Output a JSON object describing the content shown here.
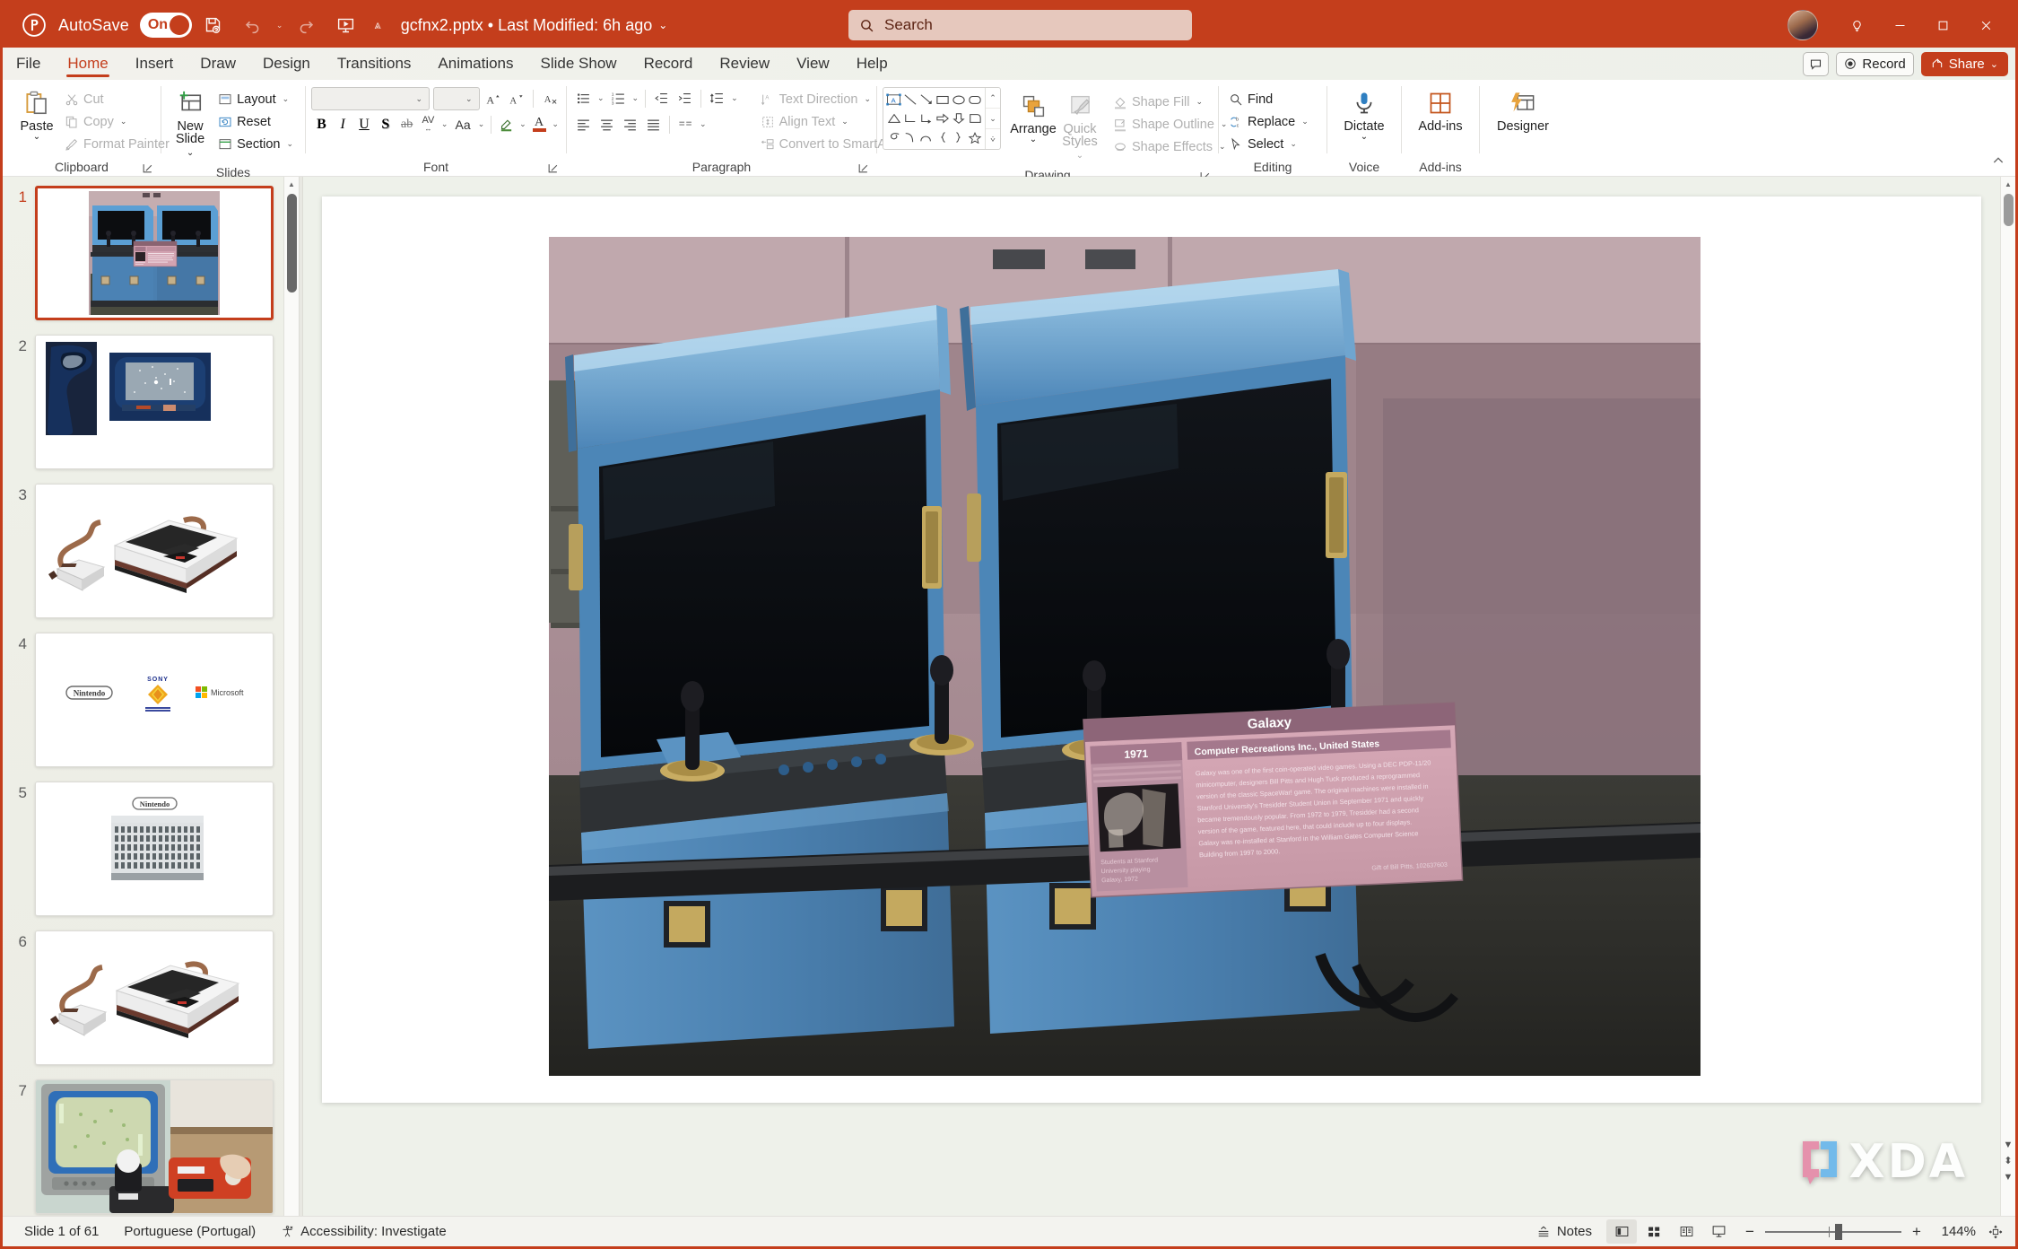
{
  "titlebar": {
    "app_icon": "powerpoint-icon",
    "autosave_label": "AutoSave",
    "autosave_state": "On",
    "filename": "gcfnx2.pptx",
    "modified": "Last Modified: 6h ago",
    "filename_full": "gcfnx2.pptx • Last Modified: 6h ago",
    "quick_access": [
      "save-icon",
      "undo-icon",
      "redo-icon",
      "start-presentation-icon",
      "customize-quick-access-icon"
    ],
    "window_controls": [
      "minimize",
      "maximize",
      "close"
    ],
    "accent_color": "#c43e1c"
  },
  "search": {
    "placeholder": "Search",
    "icon": "search-icon"
  },
  "ribbon_tabs": {
    "items": [
      "File",
      "Home",
      "Insert",
      "Draw",
      "Design",
      "Transitions",
      "Animations",
      "Slide Show",
      "Record",
      "Review",
      "View",
      "Help"
    ],
    "active": "Home",
    "comments_label": "",
    "record_label": "Record",
    "share_label": "Share"
  },
  "ribbon": {
    "groups": [
      {
        "name": "Clipboard",
        "label": "Clipboard",
        "paste": "Paste",
        "items": [
          "Cut",
          "Copy",
          "Format Painter"
        ]
      },
      {
        "name": "Slides",
        "label": "Slides",
        "new_slide": "New Slide",
        "items": [
          "Layout",
          "Reset",
          "Section"
        ]
      },
      {
        "name": "Font",
        "label": "Font",
        "font_name": "",
        "font_name_placeholder": "",
        "font_size": "",
        "buttons": [
          "increase-font-size",
          "decrease-font-size",
          "clear-formatting",
          "bold",
          "italic",
          "underline",
          "text-shadow",
          "strikethrough",
          "character-spacing",
          "change-case",
          "text-highlight-color",
          "font-color"
        ],
        "bold": "B",
        "italic": "I",
        "underline": "U",
        "shadow": "S",
        "strike": "ab",
        "spacing": "AV",
        "case": "Aa",
        "highlight": "A",
        "color": "A"
      },
      {
        "name": "Paragraph",
        "label": "Paragraph",
        "items": [
          "Text Direction",
          "Align Text",
          "Convert to SmartArt"
        ],
        "buttons": [
          "bullets",
          "numbering",
          "decrease-indent",
          "increase-indent",
          "line-spacing",
          "align-left",
          "align-center",
          "align-right",
          "justify",
          "columns"
        ]
      },
      {
        "name": "Drawing",
        "label": "Drawing",
        "arrange": "Arrange",
        "quick_styles": "Quick Styles",
        "items": [
          "Shape Fill",
          "Shape Outline",
          "Shape Effects"
        ]
      },
      {
        "name": "Editing",
        "label": "Editing",
        "items": [
          "Find",
          "Replace",
          "Select"
        ]
      },
      {
        "name": "Voice",
        "label": "Voice",
        "dictate": "Dictate"
      },
      {
        "name": "Add-ins",
        "label": "Add-ins",
        "addins": "Add-ins"
      },
      {
        "name": "Designer",
        "label": "",
        "designer": "Designer"
      }
    ]
  },
  "thumbnails": {
    "selected_index": 1,
    "slides": [
      {
        "number": "1",
        "caption": "Two blue Galaxy arcade cabinets with pink info placard"
      },
      {
        "number": "2",
        "caption": "Blue Computer Space cabinet and its screen close-up"
      },
      {
        "number": "3",
        "caption": "Magnavox Odyssey console with controller"
      },
      {
        "number": "4",
        "caption": "Nintendo, Sony Computer Entertainment, Microsoft logos"
      },
      {
        "number": "5",
        "caption": "Nintendo logo above Nintendo headquarters building"
      },
      {
        "number": "6",
        "caption": "Magnavox Odyssey console with controller"
      },
      {
        "number": "7",
        "caption": "CRT monitor showing a game next to red joystick controller"
      }
    ]
  },
  "slide": {
    "placard": {
      "title": "Galaxy",
      "year": "1971",
      "maker": "Computer Recreations Inc., United States",
      "body": "Galaxy was one of the first coin-operated video games. Using a DEC PDP-11/20 minicomputer, designers Bill Pitts and Hugh Tuck produced a reprogrammed version of the classic SpaceWar! game. The original machines were installed in Stanford University's Tresidder Student Union in September 1971 and quickly became tremendously popular. From 1972 to 1979, Tresidder had a second version of the game, featured here, that could include up to four displays. Galaxy was re-installed at Stanford in the William Gates Computer Science Building from 1997 to 2000.",
      "photo_caption": "Students at Stanford University playing Galaxy, 1972",
      "credit": "Gift of Bill Pitts, 102637603"
    }
  },
  "watermark": {
    "text": "XDA"
  },
  "status": {
    "slide_counter": "Slide 1 of 61",
    "language": "Portuguese (Portugal)",
    "accessibility": "Accessibility: Investigate",
    "notes": "Notes",
    "zoom_level": "144%",
    "views": [
      "normal-view",
      "slide-sorter-view",
      "reading-view",
      "slide-show-view"
    ],
    "active_view": "normal-view"
  }
}
